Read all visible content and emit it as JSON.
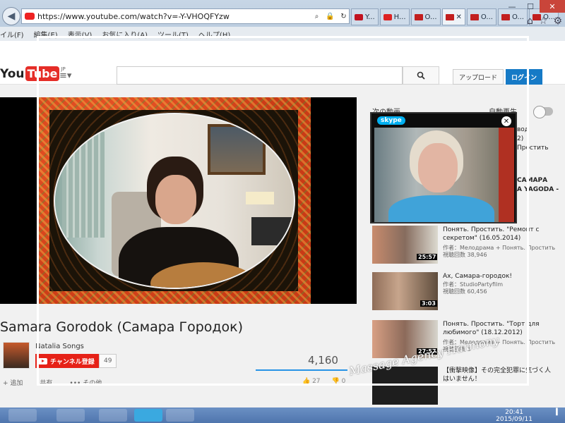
{
  "browser": {
    "url": "https://www.youtube.com/watch?v=-Y-VHOQFYzw",
    "tabs": [
      {
        "label": "Y..."
      },
      {
        "label": "H..."
      },
      {
        "label": "O..."
      },
      {
        "label": ""
      },
      {
        "label": "O..."
      },
      {
        "label": "O..."
      },
      {
        "label": "O..."
      }
    ],
    "menu": [
      "イル(F)",
      "編集(E)",
      "表示(V)",
      "お気に入り(A)",
      "ツール(T)",
      "ヘルプ(H)"
    ]
  },
  "youtube": {
    "logo_you": "You",
    "logo_tube": "Tube",
    "logo_region": "JP",
    "upload_label": "アップロード",
    "login_label": "ログイン"
  },
  "video": {
    "title": "Samara Gorodok (Самара Городок)",
    "owner": "Natalia Songs",
    "subscribe_label": "チャンネル登録",
    "subscriber_count": "49",
    "view_count": "4,160",
    "actions": [
      "+ 追加",
      "共有",
      "••• その他"
    ],
    "likes": "27",
    "dislikes": "0"
  },
  "sidebar": {
    "next_label": "次の動画",
    "autoplay_label": "自動再生",
    "partial_rec": [
      "вод",
      "2)",
      "Простить"
    ],
    "partial_rec2": [
      "САМАРА",
      "A YAGODA -"
    ],
    "related": [
      {
        "title": "Понять. Простить. \"Ремонт с секретом\" (16.05.2014)",
        "by": "作者：Мелодрама + Понять. Простить",
        "views": "視聴回数 38,946",
        "duration": "25:57"
      },
      {
        "title": "Ах, Самара-городок!",
        "by": "作者：StudioPartyfilm",
        "views": "視聴回数 60,456",
        "duration": "3:03"
      },
      {
        "title": "Понять. Простить. \"Торт для любимого\" (18.12.2012)",
        "by": "作者：Мелодрама + Понять. Простить",
        "views": "視聴回数 3",
        "duration": "27:57"
      },
      {
        "title": "【衝撃映像】その完全犯罪に気づく人はいません！",
        "by": "",
        "views": "",
        "duration": ""
      }
    ]
  },
  "skype": {
    "logo": "skype",
    "close": "✕"
  },
  "watermark": "Massage Agency Harmony",
  "taskbar": {
    "time": "20:41",
    "date": "2015/09/11"
  }
}
